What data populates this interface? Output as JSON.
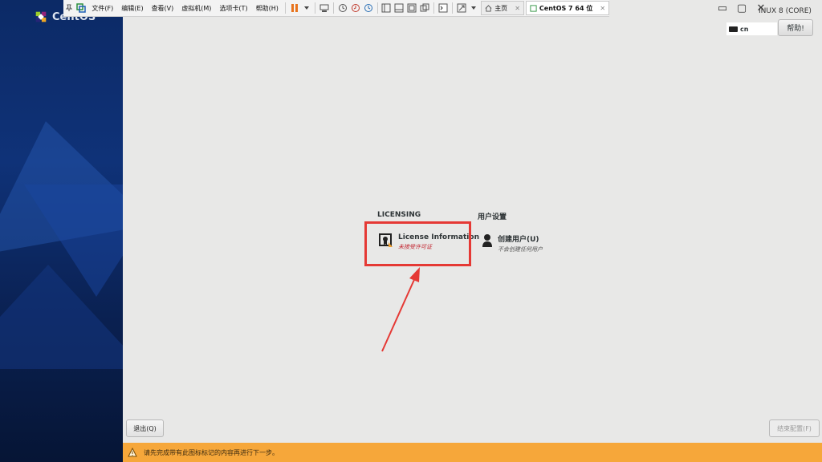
{
  "sidebar": {
    "brand": "CentOS"
  },
  "vm_toolbar": {
    "menus": [
      "文件(F)",
      "编辑(E)",
      "查看(V)",
      "虚拟机(M)",
      "选项卡(T)",
      "帮助(H)"
    ],
    "tabs": [
      {
        "label": "主页",
        "active": false
      },
      {
        "label": "CentOS 7 64 位",
        "active": true
      }
    ]
  },
  "header": {
    "product_name": "INUX 8 (CORE)",
    "keyboard_layout": "cn",
    "help_label": "帮助!"
  },
  "hub": {
    "categories": [
      {
        "title": "LICENSING",
        "spokes": [
          {
            "name": "License Information",
            "status": "未接受许可证",
            "warning": true
          }
        ]
      },
      {
        "title": "用户设置",
        "spokes": [
          {
            "name": "创建用户(U)",
            "status": "不会创建任何用户",
            "warning": false
          }
        ]
      }
    ]
  },
  "buttons": {
    "quit_label": "退出(Q)",
    "finish_label": "结束配置(F)"
  },
  "warning_bar": {
    "message": "请先完成带有此图标标记的内容再进行下一步。"
  },
  "colors": {
    "warning_bar": "#f6a73a",
    "annotation": "#e53935",
    "sidebar": "#0c2a66"
  }
}
